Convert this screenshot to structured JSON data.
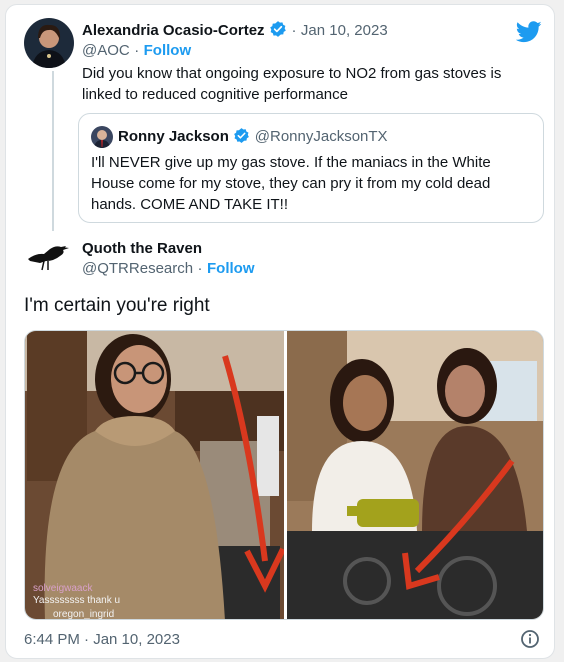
{
  "original": {
    "name": "Alexandria Ocasio-Cortez",
    "handle": "@AOC",
    "date": "Jan 10, 2023",
    "follow": "Follow",
    "dot": "·",
    "text": "Did you know that ongoing exposure to NO2 from gas stoves is linked to reduced cognitive performance"
  },
  "quoted": {
    "name": "Ronny Jackson",
    "handle": "@RonnyJacksonTX",
    "text": "I'll NEVER give up my gas stove. If the maniacs in the White House come for my stove, they can pry it from my cold dead hands. COME AND TAKE IT!!"
  },
  "reply": {
    "name": "Quoth the Raven",
    "handle": "@QTRResearch",
    "follow": "Follow",
    "dot": "·",
    "text": "I'm certain you're right"
  },
  "media": {
    "overlay_user1": "solveigwaack",
    "overlay_comment1": "Yassssssss thank u",
    "overlay_user2": "oregon_ingrid"
  },
  "footer": {
    "timestamp": "6:44 PM · Jan 10, 2023"
  },
  "colors": {
    "brand": "#1d9bf0",
    "arrow": "#d9381e",
    "text": "#0f1419",
    "muted": "#536471"
  },
  "icons": [
    "twitter-bird-icon",
    "verified-badge-icon",
    "raven-avatar",
    "info-icon"
  ]
}
